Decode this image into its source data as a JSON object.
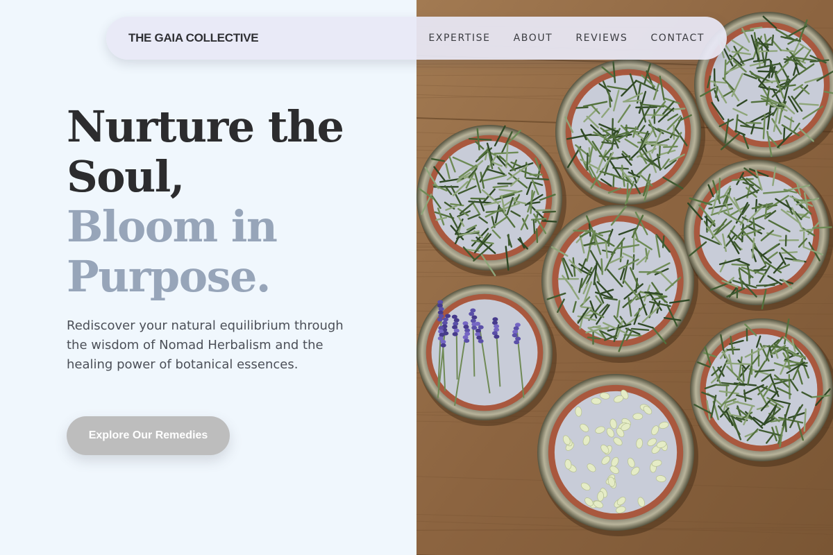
{
  "brand": {
    "name": "THE GAIA COLLECTIVE"
  },
  "nav": {
    "links": [
      "EXPERTISE",
      "ABOUT",
      "REVIEWS",
      "CONTACT"
    ]
  },
  "hero": {
    "title_dark": [
      "Nurture the",
      "Soul,"
    ],
    "title_light": [
      "Bloom in",
      "Purpose."
    ],
    "subtitle": "Rediscover your natural equilibrium through the wisdom of Nomad Herbalism and the healing power of botanical essences.",
    "cta_label": "Explore Our Remedies"
  },
  "image": {
    "subject": "tins-of-herbs-rosemary-lavender-beans-photo"
  },
  "colors": {
    "page_bg": "#f0f7fd",
    "title_dark": "#2c2c2e",
    "title_light": "#97a5b9",
    "nav_bg": "#e8e8f6",
    "cta_bg": "#bdbdbd"
  }
}
